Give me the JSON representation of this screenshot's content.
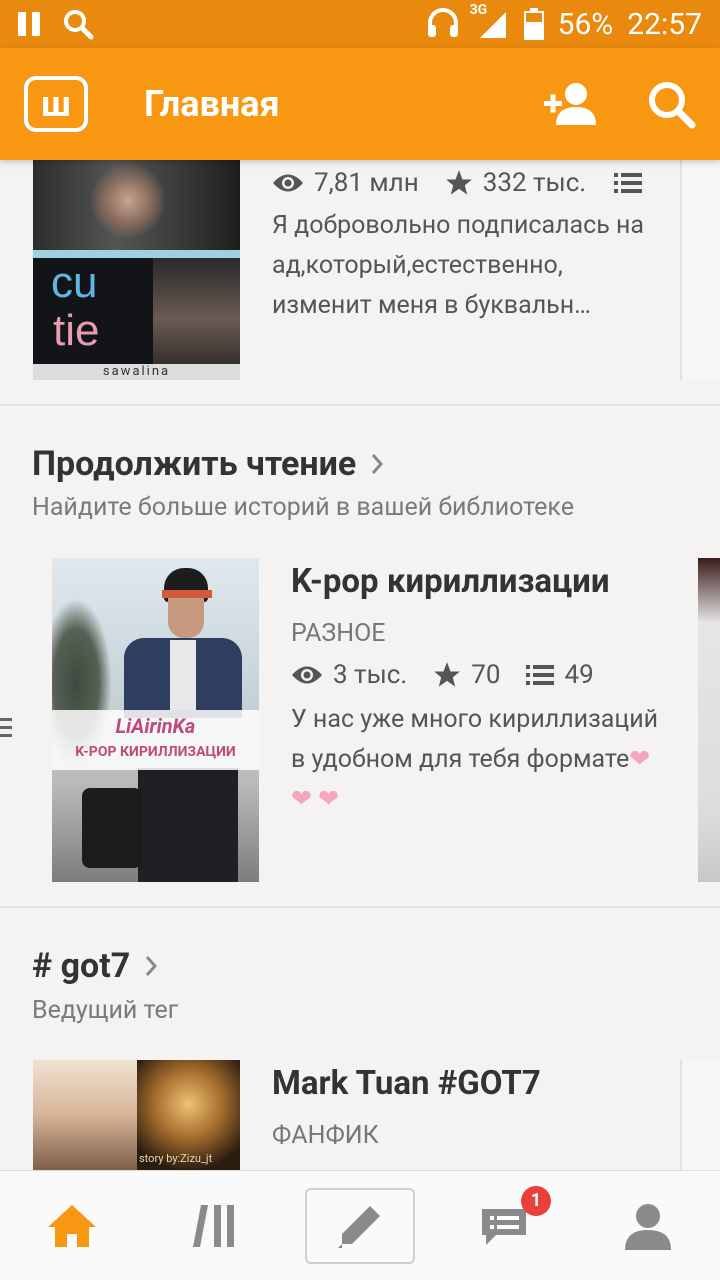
{
  "status_bar": {
    "network": "3G",
    "battery": "56%",
    "time": "22:57"
  },
  "app_bar": {
    "logo_letter": "ш",
    "title": "Главная"
  },
  "story_top": {
    "views": "7,81 млн",
    "votes": "332 тыс.",
    "description": "Я добровольно подписалась на ад,который,естественно, изменит меня  в буквальн…",
    "cover_text_1": "cu",
    "cover_text_2": "tie",
    "cover_author": "sawalina"
  },
  "continue_reading": {
    "title": "Продолжить чтение",
    "subtitle": "Найдите больше историй в вашей библиотеке",
    "story": {
      "title": "K-pop кириллизации",
      "category": "РАЗНОЕ",
      "views": "3 тыс.",
      "votes": "70",
      "parts": "49",
      "description": "У нас уже много кириллизаций в удобном для тебя формате",
      "hearts": "❤ ❤ ❤",
      "cover_author": "LiAirinKa",
      "cover_title": "K-POP КИРИЛЛИЗАЦИИ"
    }
  },
  "tag_section": {
    "title": "# got7",
    "subtitle": "Ведущий тег",
    "story": {
      "title": "Mark Tuan #GOT7",
      "category": "ФАНФИК",
      "cover_caption": "story by:Zizu_jt"
    }
  },
  "bottom_nav": {
    "messages_badge": "1"
  },
  "colors": {
    "accent": "#f79712",
    "status_bar": "#e98a0e",
    "heart": "#f4a6bd"
  }
}
